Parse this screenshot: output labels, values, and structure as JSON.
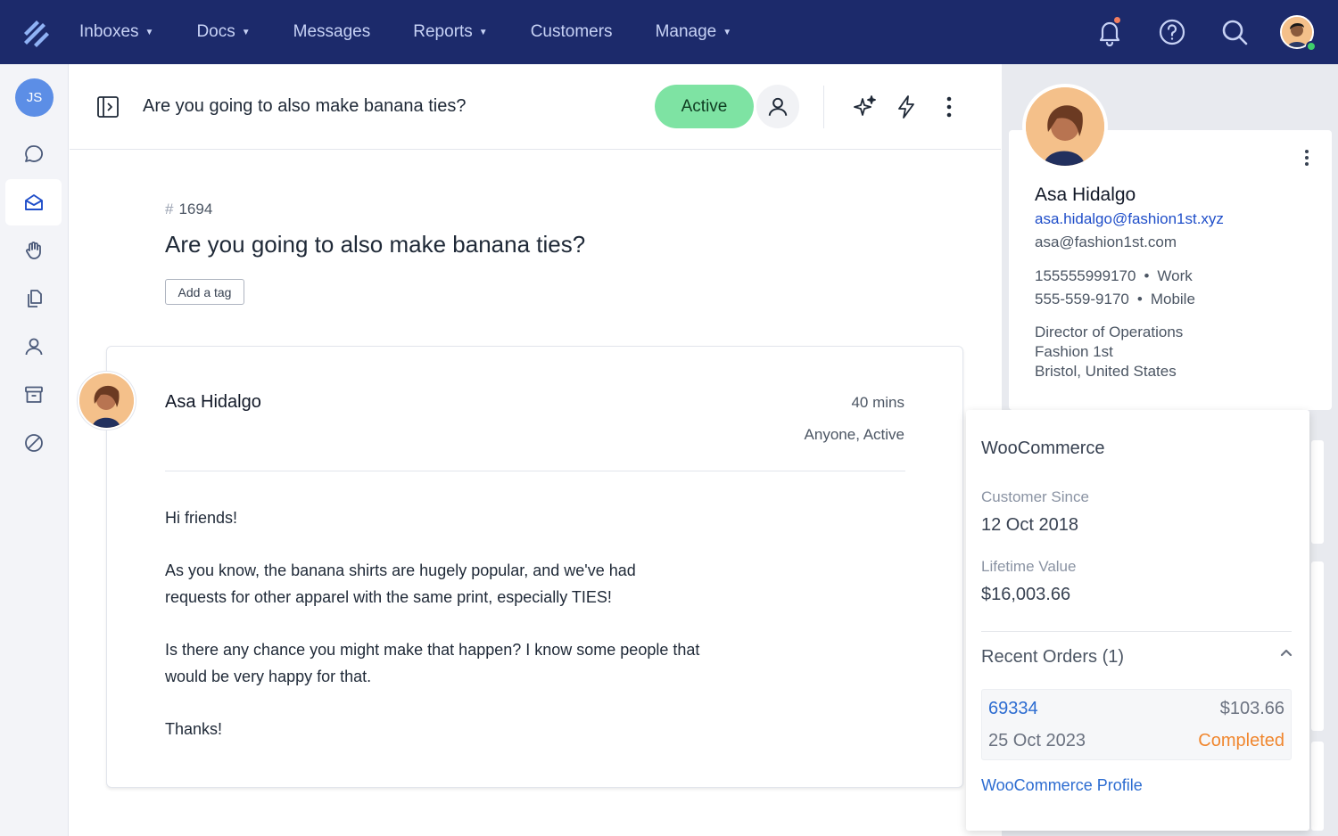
{
  "nav": {
    "items": [
      {
        "label": "Inboxes",
        "has_caret": true
      },
      {
        "label": "Docs",
        "has_caret": true
      },
      {
        "label": "Messages",
        "has_caret": false
      },
      {
        "label": "Reports",
        "has_caret": true
      },
      {
        "label": "Customers",
        "has_caret": false
      },
      {
        "label": "Manage",
        "has_caret": true
      }
    ],
    "caret_glyph": "▼",
    "icons": [
      "bell-icon",
      "help-icon",
      "search-icon"
    ],
    "colors": {
      "bg": "#1c2a6b",
      "text": "#c7d2f5"
    }
  },
  "sidebar": {
    "user_initials": "JS",
    "items": [
      "chat-icon",
      "inbox-icon",
      "hand-icon",
      "docs-icon",
      "customer-icon",
      "archive-icon",
      "spam-icon"
    ],
    "active_index": 1
  },
  "conversation": {
    "title": "Are you going to also make banana ties?",
    "status": "Active",
    "hash": "#",
    "number": "1694",
    "subject": "Are you going to also make banana ties?",
    "add_tag_label": "Add a tag",
    "status_color": "#7ee3a3"
  },
  "message": {
    "author": "Asa Hidalgo",
    "time": "40 mins",
    "visibility": "Anyone, Active",
    "paragraphs": [
      "Hi friends!",
      "As you know, the banana shirts are hugely popular, and we've had requests for other apparel with the same print, especially TIES!",
      "Is there any chance you might make that happen? I know some people that would be very happy for that.",
      "Thanks!"
    ]
  },
  "customer": {
    "name": "Asa Hidalgo",
    "email_primary": "asa.hidalgo@fashion1st.xyz",
    "email_secondary": "asa@fashion1st.com",
    "phones": [
      {
        "number": "155555999170",
        "type": "Work"
      },
      {
        "number": "555-559-9170",
        "type": "Mobile"
      }
    ],
    "bullet": "•",
    "job_title": "Director of Operations",
    "company": "Fashion 1st",
    "location": "Bristol, United States"
  },
  "woocommerce": {
    "title": "WooCommerce",
    "customer_since_label": "Customer Since",
    "customer_since": "12 Oct 2018",
    "lifetime_value_label": "Lifetime Value",
    "lifetime_value": "$16,003.66",
    "recent_orders_label": "Recent Orders (1)",
    "orders": [
      {
        "id": "69334",
        "total": "$103.66",
        "date": "25 Oct 2023",
        "status": "Completed"
      }
    ],
    "profile_link": "WooCommerce Profile",
    "colors": {
      "link": "#2c6cd1",
      "completed": "#f0872f"
    }
  }
}
